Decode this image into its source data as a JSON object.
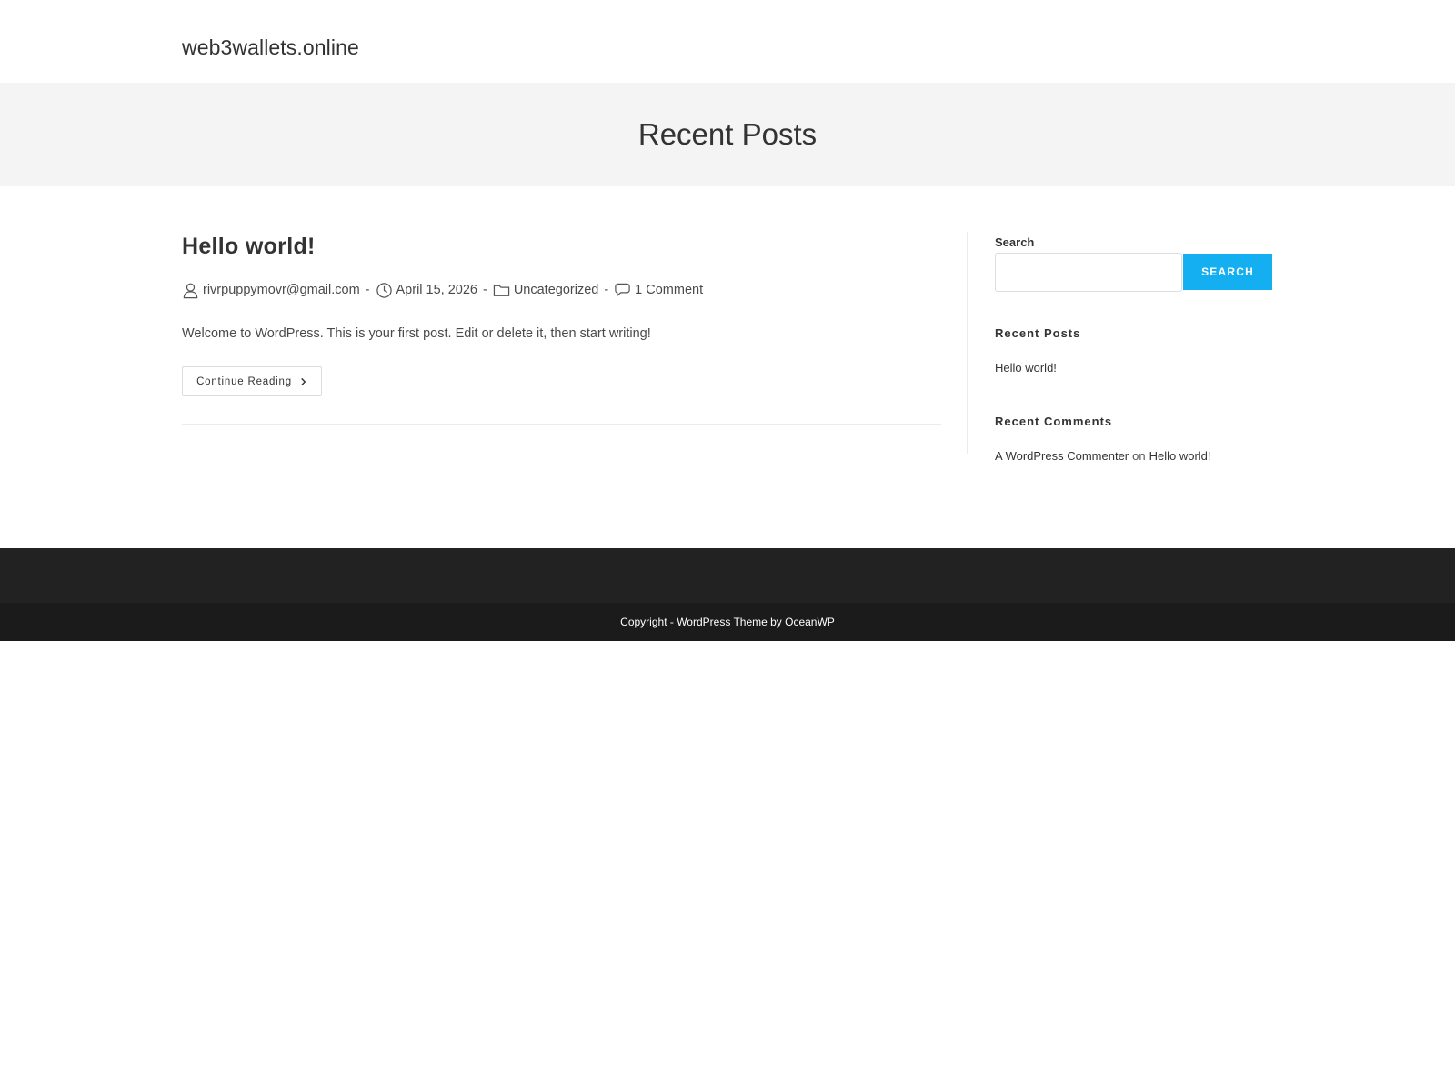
{
  "site": {
    "title": "web3wallets.online"
  },
  "page_header": {
    "title": "Recent Posts"
  },
  "post": {
    "title": "Hello world!",
    "author": "rivrpuppymovr@gmail.com",
    "date": "April 15, 2026",
    "category": "Uncategorized",
    "comments": "1 Comment",
    "separator": "-",
    "excerpt": "Welcome to WordPress. This is your first post. Edit or delete it, then start writing!",
    "continue_label": "Continue Reading"
  },
  "sidebar": {
    "search_label": "Search",
    "search_value": "",
    "search_button": "Search",
    "recent_posts_title": "Recent Posts",
    "recent_posts": [
      "Hello world!"
    ],
    "recent_comments_title": "Recent Comments",
    "recent_comment": {
      "author": "A WordPress Commenter",
      "on": "on",
      "post": "Hello world!"
    }
  },
  "footer": {
    "copyright": "Copyright - WordPress Theme by OceanWP"
  },
  "colors": {
    "accent": "#13aff0",
    "footer_top": "#222222",
    "footer_bottom": "#1b1b1b",
    "page_header_bg": "#f4f4f4"
  },
  "icons": {
    "author": "user-icon",
    "date": "clock-icon",
    "category": "folder-icon",
    "comments": "comment-icon",
    "continue": "chevron-right-icon"
  }
}
